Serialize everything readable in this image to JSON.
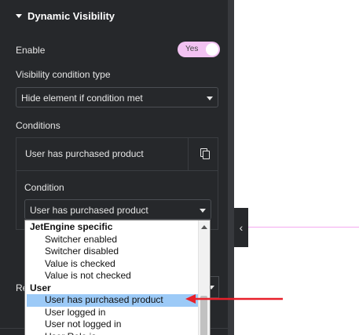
{
  "section": {
    "title": "Dynamic Visibility"
  },
  "enable": {
    "label": "Enable",
    "toggle_text": "Yes"
  },
  "visibility_type": {
    "label": "Visibility condition type",
    "value": "Hide element if condition met"
  },
  "conditions": {
    "label": "Conditions",
    "item_title": "User has purchased product",
    "condition_label": "Condition",
    "condition_value": "User has purchased product"
  },
  "behind": {
    "label_partial": "Re"
  },
  "dropdown": {
    "items": [
      {
        "text": "JetEngine specific",
        "type": "group"
      },
      {
        "text": "Switcher enabled",
        "type": "option"
      },
      {
        "text": "Switcher disabled",
        "type": "option"
      },
      {
        "text": "Value is checked",
        "type": "option"
      },
      {
        "text": "Value is not checked",
        "type": "option"
      },
      {
        "text": "User",
        "type": "group"
      },
      {
        "text": "User has purchased product",
        "type": "option",
        "selected": true
      },
      {
        "text": "User logged in",
        "type": "option"
      },
      {
        "text": "User not logged in",
        "type": "option"
      },
      {
        "text": "User Role is",
        "type": "option"
      }
    ]
  },
  "icons": {
    "panel_collapse": "chevron-left-icon",
    "copy": "copy-icon",
    "annotation": "red-arrow-icon"
  },
  "colors": {
    "toggle_on": "#f2c2f2",
    "selection": "#9ccaf7",
    "annotation_arrow": "#e8202a",
    "panel_bg": "#26282b"
  }
}
